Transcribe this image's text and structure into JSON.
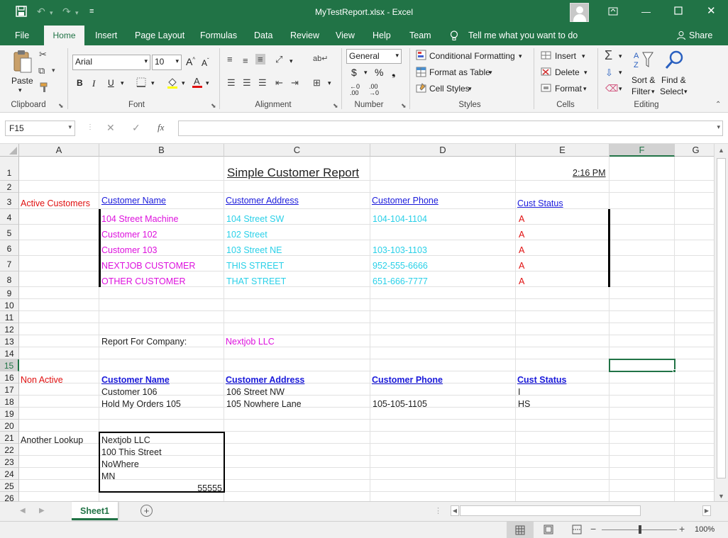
{
  "window": {
    "title": "MyTestReport.xlsx  -  Excel"
  },
  "tabs": {
    "file": "File",
    "home": "Home",
    "insert": "Insert",
    "page_layout": "Page Layout",
    "formulas": "Formulas",
    "data": "Data",
    "review": "Review",
    "view": "View",
    "help": "Help",
    "team": "Team",
    "tell_me": "Tell me what you want to do",
    "share": "Share"
  },
  "ribbon": {
    "clipboard": {
      "paste": "Paste",
      "label": "Clipboard"
    },
    "font": {
      "name": "Arial",
      "size": "10",
      "label": "Font"
    },
    "alignment": {
      "label": "Alignment"
    },
    "number": {
      "format": "General",
      "label": "Number"
    },
    "styles": {
      "conditional": "Conditional Formatting",
      "table": "Format as Table",
      "cell": "Cell Styles",
      "label": "Styles"
    },
    "cells": {
      "insert": "Insert",
      "delete": "Delete",
      "format": "Format",
      "label": "Cells"
    },
    "editing": {
      "sort1": "Sort &",
      "sort2": "Filter",
      "find1": "Find &",
      "find2": "Select",
      "label": "Editing"
    }
  },
  "formula_bar": {
    "name_box": "F15",
    "value": ""
  },
  "columns": [
    "A",
    "B",
    "C",
    "D",
    "E",
    "F",
    "G"
  ],
  "rows": [
    "1",
    "2",
    "3",
    "4",
    "5",
    "6",
    "7",
    "8",
    "9",
    "10",
    "11",
    "12",
    "13",
    "14",
    "15",
    "16",
    "17",
    "18",
    "19",
    "20",
    "21",
    "22",
    "23",
    "24",
    "25",
    "26"
  ],
  "cells": {
    "C1": "Simple Customer Report",
    "E1": "2:16 PM",
    "A3": "Active Customers",
    "B3": "Customer Name",
    "C3": "Customer Address",
    "D3": "Customer Phone",
    "E3": "Cust Status",
    "B4": "104 Street Machine",
    "C4": "104 Street SW",
    "D4": "104-104-1104",
    "E4": "A",
    "B5": "Customer 102",
    "C5": "102 Street",
    "E5": "A",
    "B6": "Customer 103",
    "C6": "103 Street NE",
    "D6": "103-103-1103",
    "E6": "A",
    "B7": "NEXTJOB CUSTOMER",
    "C7": "THIS STREET",
    "D7": "952-555-6666",
    "E7": "A",
    "B8": "OTHER CUSTOMER",
    "C8": "THAT STREET",
    "D8": "651-666-7777",
    "E8": "A",
    "B13": "Report For Company:",
    "C13": "Nextjob LLC",
    "A16": "Non Active",
    "B16": "Customer Name",
    "C16": "Customer Address",
    "D16": "Customer Phone",
    "E16": "Cust Status",
    "B17": "Customer 106",
    "C17": "106 Street NW",
    "E17": "I",
    "B18": "Hold My Orders 105",
    "C18": "105 Nowhere Lane",
    "D18": "105-105-1105",
    "E18": "HS",
    "A21": "Another Lookup",
    "B21": "Nextjob LLC",
    "B22": "100 This Street",
    "B23": "NoWhere",
    "B24": "MN",
    "B25": "55555"
  },
  "sheets": [
    {
      "name": "Sheet1",
      "active": true
    }
  ],
  "status": {
    "zoom": "100%"
  },
  "colors": {
    "accent": "#217346",
    "link_blue": "#1a1adb",
    "magenta": "#dd10dd",
    "cyan": "#2ad0e8",
    "red": "#e01010"
  }
}
